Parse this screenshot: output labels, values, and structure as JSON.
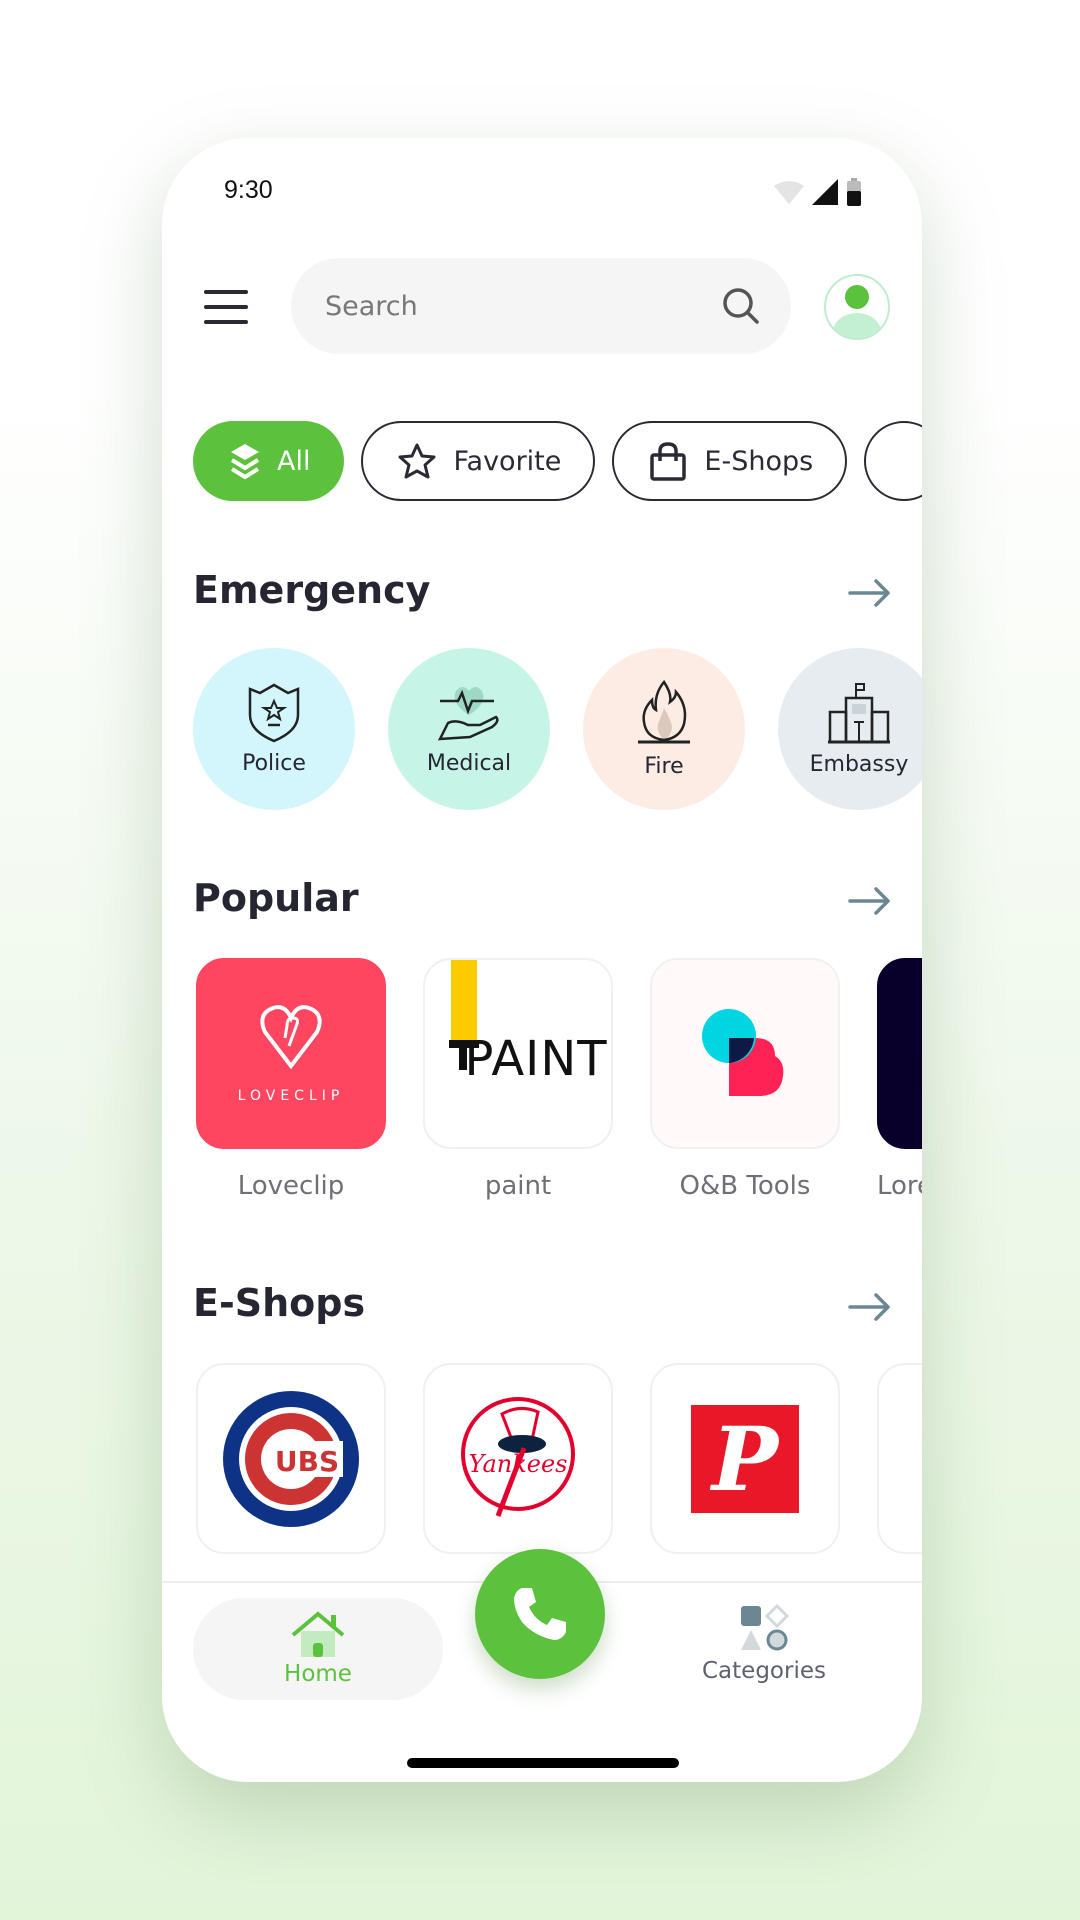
{
  "status_bar": {
    "time": "9:30",
    "icons": [
      "wifi-icon",
      "signal-icon",
      "battery-icon"
    ]
  },
  "header": {
    "menu_icon": "menu-icon",
    "search": {
      "placeholder": "Search",
      "value": "",
      "icon": "search-icon"
    },
    "avatar_icon": "user-icon"
  },
  "chips": [
    {
      "label": "All",
      "icon": "layers-icon",
      "active": true
    },
    {
      "label": "Favorite",
      "icon": "star-icon",
      "active": false
    },
    {
      "label": "E-Shops",
      "icon": "shopping-bag-icon",
      "active": false
    }
  ],
  "sections": {
    "emergency": {
      "title": "Emergency",
      "items": [
        {
          "label": "Police",
          "color": "#d3f6fc",
          "icon": "police-badge-icon"
        },
        {
          "label": "Medical",
          "color": "#c6f5e8",
          "icon": "medical-hand-heart-icon"
        },
        {
          "label": "Fire",
          "color": "#fdece4",
          "icon": "fire-icon"
        },
        {
          "label": "Embassy",
          "color": "#e6ecef",
          "icon": "building-icon"
        }
      ]
    },
    "popular": {
      "title": "Popular",
      "items": [
        {
          "label": "Loveclip",
          "logo_text": "LOVECLIP"
        },
        {
          "label": "paint",
          "logo_text": "PAINT"
        },
        {
          "label": "O&B Tools"
        },
        {
          "label": "Lore"
        }
      ]
    },
    "eshops": {
      "title": "E-Shops",
      "items": [
        {
          "name": "Cubs",
          "logo_text": "UBS"
        },
        {
          "name": "Yankees",
          "logo_text": "Yankees"
        },
        {
          "name": "Phillies",
          "logo_text": "P"
        }
      ]
    }
  },
  "bottom_nav": {
    "home": "Home",
    "categories": "Categories",
    "call_icon": "phone-icon"
  },
  "colors": {
    "accent": "#5cc13d",
    "text": "#262633"
  }
}
